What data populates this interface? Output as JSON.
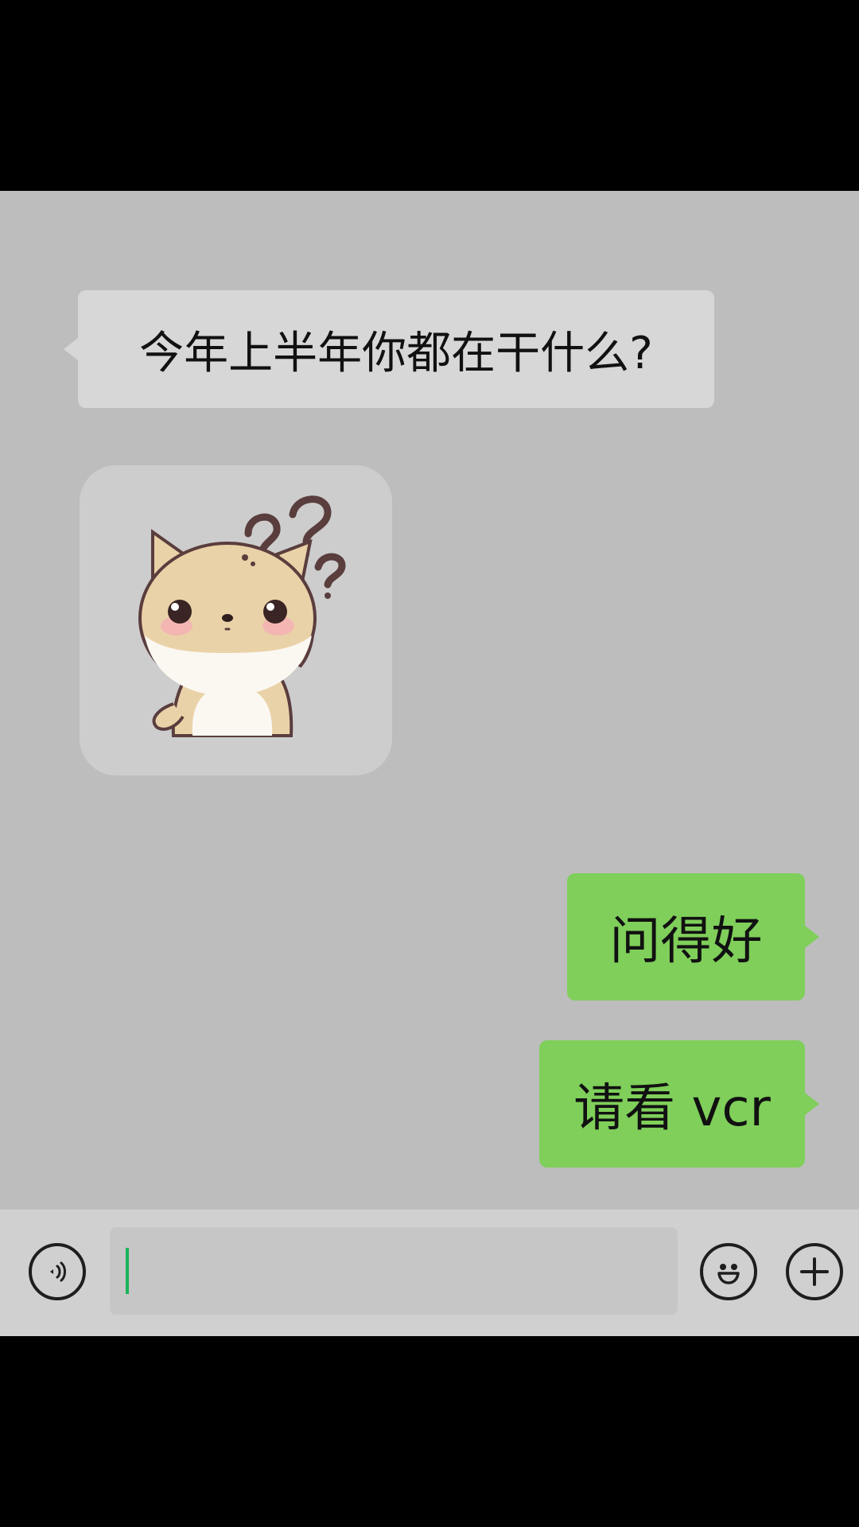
{
  "messages": [
    {
      "direction": "incoming",
      "type": "text",
      "text": "今年上半年你都在干什么?"
    },
    {
      "direction": "incoming",
      "type": "sticker",
      "sticker": "confused-puppy-question-marks"
    },
    {
      "direction": "outgoing",
      "type": "text",
      "text": "问得好"
    },
    {
      "direction": "outgoing",
      "type": "text",
      "text": "请看 vcr"
    }
  ],
  "input_bar": {
    "voice_icon": "voice-icon",
    "text_value": "",
    "emoji_icon": "emoji-icon",
    "plus_icon": "plus-icon"
  },
  "colors": {
    "chat_background": "#bdbdbd",
    "incoming_bubble": "#d7d7d7",
    "outgoing_bubble": "#7fcf5a",
    "cursor": "#19b35a"
  }
}
